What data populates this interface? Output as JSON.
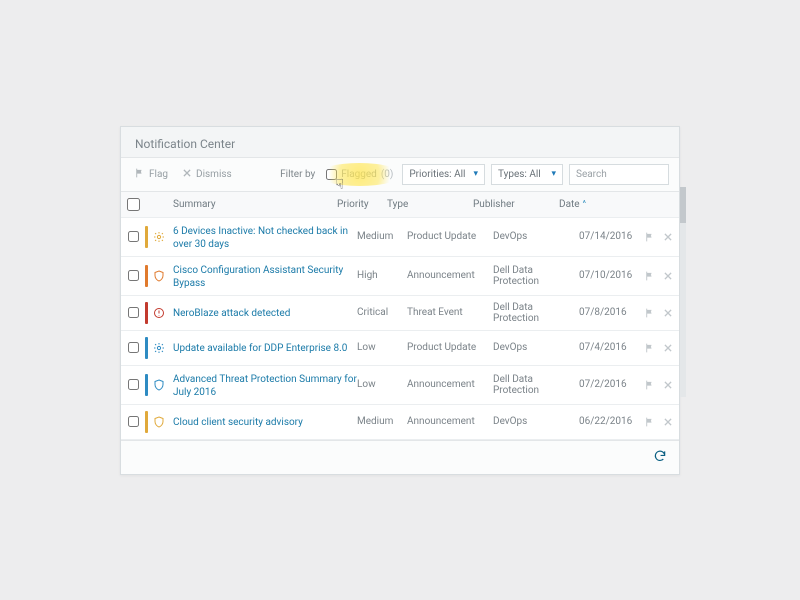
{
  "title": "Notification Center",
  "toolbar": {
    "flag": "Flag",
    "dismiss": "Dismiss",
    "filter_by": "Filter by",
    "flagged_label": "Flagged",
    "flagged_count": "(0)",
    "priorities_select": "Priorities: All",
    "types_select": "Types: All",
    "search_placeholder": "Search"
  },
  "columns": {
    "summary": "Summary",
    "priority": "Priority",
    "type": "Type",
    "publisher": "Publisher",
    "date": "Date"
  },
  "sort": {
    "column": "date",
    "dir": "asc"
  },
  "rows": [
    {
      "summary": "6 Devices Inactive: Not checked back in over 30 days",
      "priority": "Medium",
      "type": "Product Update",
      "publisher": "DevOps",
      "date": "07/14/2016",
      "sev_color": "#e0a93b",
      "icon": "gear"
    },
    {
      "summary": "Cisco Configuration Assistant Security Bypass",
      "priority": "High",
      "type": "Announcement",
      "publisher": "Dell Data Protection",
      "date": "07/10/2016",
      "sev_color": "#e07a2d",
      "icon": "shield"
    },
    {
      "summary": "NeroBlaze attack detected",
      "priority": "Critical",
      "type": "Threat Event",
      "publisher": "Dell Data Protection",
      "date": "07/8/2016",
      "sev_color": "#c23a2e",
      "icon": "alert"
    },
    {
      "summary": "Update available for DDP Enterprise 8.0",
      "priority": "Low",
      "type": "Product Update",
      "publisher": "DevOps",
      "date": "07/4/2016",
      "sev_color": "#2e8bc2",
      "icon": "gear"
    },
    {
      "summary": "Advanced Threat Protection Summary for July 2016",
      "priority": "Low",
      "type": "Announcement",
      "publisher": "Dell Data Protection",
      "date": "07/2/2016",
      "sev_color": "#2e8bc2",
      "icon": "shield"
    },
    {
      "summary": "Cloud client security advisory",
      "priority": "Medium",
      "type": "Announcement",
      "publisher": "DevOps",
      "date": "06/22/2016",
      "sev_color": "#e0a93b",
      "icon": "shield"
    }
  ]
}
